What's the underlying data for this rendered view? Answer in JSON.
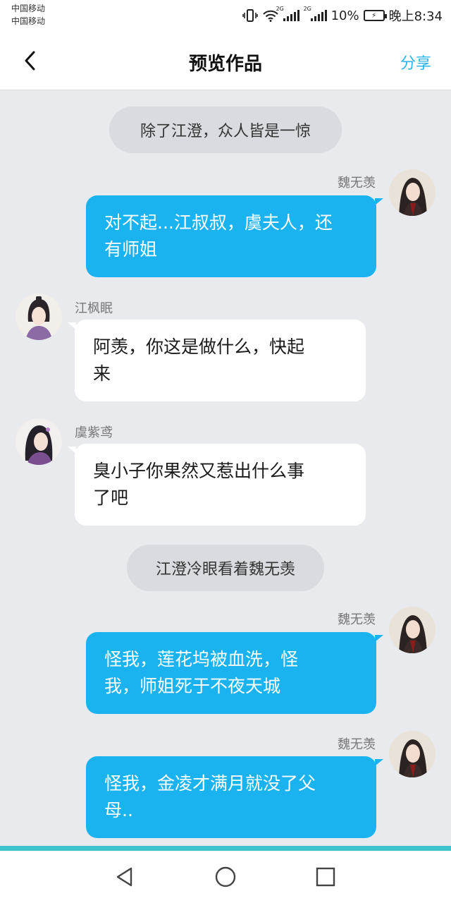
{
  "status_bar": {
    "carrier_1": "中国移动",
    "carrier_2": "中国移动",
    "net_1": "2G",
    "net_2": "2G",
    "battery": "10%",
    "time": "晚上8:34"
  },
  "header": {
    "back_icon": "chevron-left-icon",
    "title": "预览作品",
    "share_label": "分享"
  },
  "messages": [
    {
      "type": "narration",
      "text": "除了江澄，众人皆是一惊"
    },
    {
      "type": "right",
      "name": "魏无羡",
      "lines": [
        "对不起...江叔叔，虞夫人，还",
        "有师姐"
      ]
    },
    {
      "type": "left",
      "name": "江枫眠",
      "lines": [
        "阿羡，你这是做什么，快起",
        "来"
      ]
    },
    {
      "type": "left",
      "name": "虞紫鸢",
      "lines": [
        "臭小子你果然又惹出什么事",
        "了吧"
      ]
    },
    {
      "type": "narration",
      "text": "江澄冷眼看着魏无羡"
    },
    {
      "type": "right",
      "name": "魏无羡",
      "lines": [
        "怪我，莲花坞被血洗，怪",
        "我，师姐死于不夜天城"
      ]
    },
    {
      "type": "right",
      "name": "魏无羡",
      "lines": [
        "怪我，金凌才满月就没了父",
        "母.."
      ]
    }
  ],
  "nav": {
    "back_icon": "triangle-back-icon",
    "home_icon": "circle-home-icon",
    "recents_icon": "square-recents-icon"
  },
  "colors": {
    "accent": "#2bb5e8",
    "bubble_right": "#1ab3f0",
    "bubble_left": "#ffffff",
    "background": "#e9eaee",
    "narration": "#d9dbe1"
  }
}
